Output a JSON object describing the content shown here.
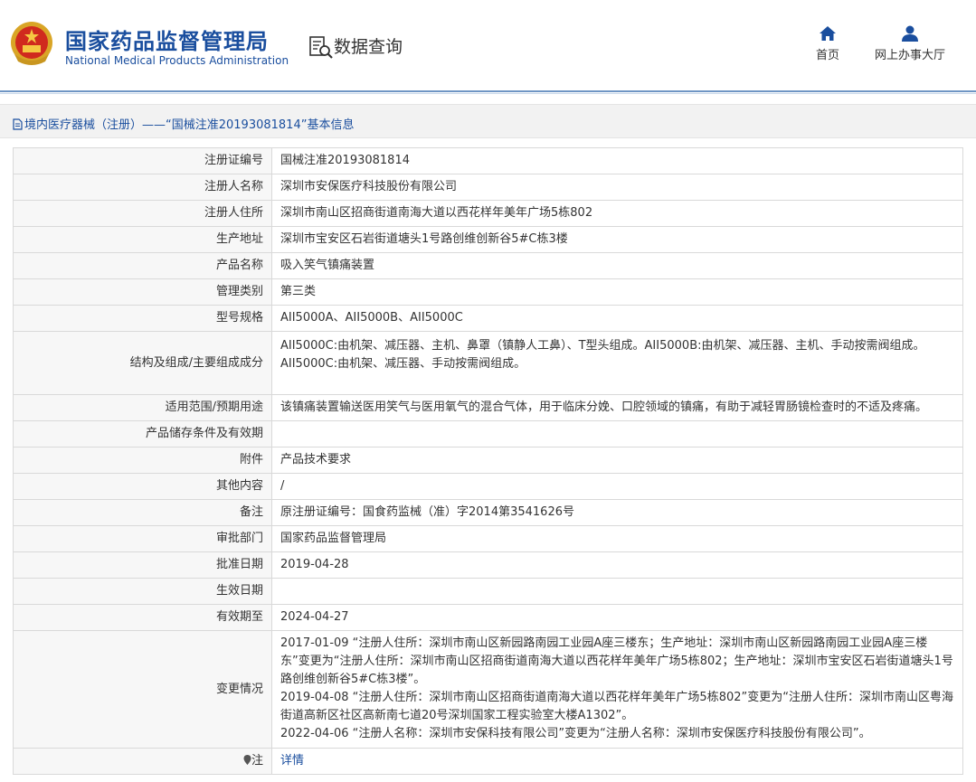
{
  "header": {
    "logo_cn": "国家药品监督管理局",
    "logo_en": "National Medical Products Administration",
    "db_title": "数据查询",
    "nav": [
      {
        "label": "首页",
        "icon": "home-icon"
      },
      {
        "label": "网上办事大厅",
        "icon": "user-icon"
      }
    ]
  },
  "breadcrumb": {
    "text": "境内医疗器械（注册）——“国械注准20193081814”基本信息",
    "icon": "document-icon"
  },
  "rows": [
    {
      "label": "注册证编号",
      "value": "国械注准20193081814"
    },
    {
      "label": "注册人名称",
      "value": "深圳市安保医疗科技股份有限公司"
    },
    {
      "label": "注册人住所",
      "value": "深圳市南山区招商街道南海大道以西花样年美年广场5栋802"
    },
    {
      "label": "生产地址",
      "value": "深圳市宝安区石岩街道塘头1号路创维创新谷5#C栋3楼"
    },
    {
      "label": "产品名称",
      "value": "吸入笑气镇痛装置"
    },
    {
      "label": "管理类别",
      "value": "第三类"
    },
    {
      "label": "型号规格",
      "value": "AII5000A、AII5000B、AII5000C"
    },
    {
      "label": "结构及组成/主要组成成分",
      "value": "AII5000C:由机架、减压器、主机、鼻罩（镇静人工鼻）、T型头组成。AII5000B:由机架、减压器、主机、手动按需阀组成。AII5000C:由机架、减压器、手动按需阀组成。"
    },
    {
      "label": "适用范围/预期用途",
      "value": "该镇痛装置输送医用笑气与医用氧气的混合气体，用于临床分娩、口腔领域的镇痛，有助于减轻胃肠镜检查时的不适及疼痛。"
    },
    {
      "label": "产品储存条件及有效期",
      "value": ""
    },
    {
      "label": "附件",
      "value": "产品技术要求"
    },
    {
      "label": "其他内容",
      "value": "/"
    },
    {
      "label": "备注",
      "value": "原注册证编号：国食药监械（准）字2014第3541626号"
    },
    {
      "label": "审批部门",
      "value": "国家药品监督管理局"
    },
    {
      "label": "批准日期",
      "value": "2019-04-28"
    },
    {
      "label": "生效日期",
      "value": ""
    },
    {
      "label": "有效期至",
      "value": "2024-04-27"
    }
  ],
  "changes": {
    "label": "变更情况",
    "entries": [
      "2017-01-09 “注册人住所：深圳市南山区新园路南园工业园A座三楼东；生产地址：深圳市南山区新园路南园工业园A座三楼东”变更为“注册人住所：深圳市南山区招商街道南海大道以西花样年美年广场5栋802；生产地址：深圳市宝安区石岩街道塘头1号路创维创新谷5#C栋3楼”。",
      "2019-04-08 “注册人住所：深圳市南山区招商街道南海大道以西花样年美年广场5栋802”变更为“注册人住所：深圳市南山区粤海街道高新区社区高新南七道20号深圳国家工程实验室大楼A1302”。",
      "2022-04-06 “注册人名称：深圳市安保科技有限公司”变更为“注册人名称：深圳市安保医疗科技股份有限公司”。"
    ]
  },
  "note": {
    "label": "注",
    "link": "详情",
    "icon": "location-pin-icon"
  },
  "colors": {
    "brand_blue": "#1a4e9e",
    "label_bg": "#f7f7f7",
    "border": "#d9d9d9"
  }
}
